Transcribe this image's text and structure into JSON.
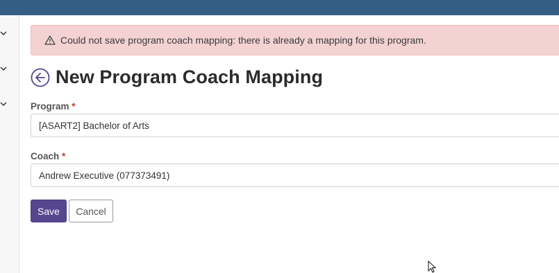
{
  "alert": {
    "icon": "warning-triangle-icon",
    "message": "Could not save program coach mapping: there is already a mapping for this program."
  },
  "header": {
    "back_icon": "arrow-left-circle-icon",
    "title": "New Program Coach Mapping"
  },
  "form": {
    "program": {
      "label": "Program",
      "required_marker": "*",
      "value": "[ASART2] Bachelor of Arts"
    },
    "coach": {
      "label": "Coach",
      "required_marker": "*",
      "value": "Andrew Executive (077373491)"
    },
    "save_label": "Save",
    "cancel_label": "Cancel"
  },
  "colors": {
    "topbar": "#355e85",
    "alert_bg": "#f4d2d2",
    "primary": "#55468f"
  }
}
